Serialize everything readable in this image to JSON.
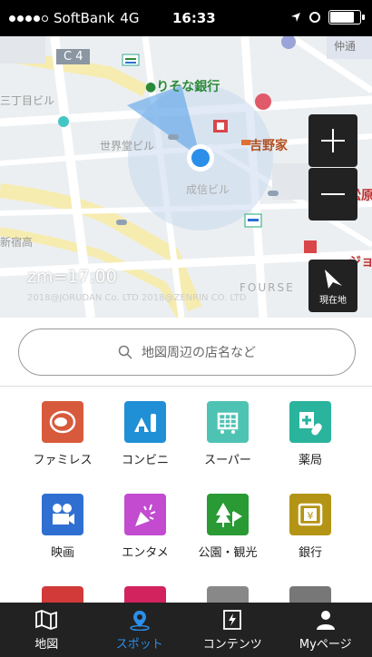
{
  "status_bar": {
    "carrier": "SoftBank",
    "network": "4G",
    "time": "16:33"
  },
  "map": {
    "labels": {
      "c4": "C 4",
      "resona": "りそな銀行",
      "sanchome": "三丁目ビル",
      "sekaido": "世界堂ビル",
      "yoshinoya": "吉野家",
      "seishin": "成信ビル",
      "matsumoto": "松原",
      "shinjuku_taka": "新宿高",
      "naka": "仲通",
      "fourse": "FOURSE",
      "jo": "ジョ"
    },
    "zoom_label": "zm=17.00",
    "copyright": "2018@JORUDAN Co. LTD 2018@ZENRIN CO. LTD",
    "location_caption": "現在地"
  },
  "search": {
    "placeholder": "地図周辺の店名など"
  },
  "categories": [
    {
      "label": "ファミレス",
      "color": "#d85a3c",
      "icon": "food-plate-icon"
    },
    {
      "label": "コンビニ",
      "color": "#1f8fd6",
      "icon": "onigiri-bottle-icon"
    },
    {
      "label": "スーパー",
      "color": "#4fc3b3",
      "icon": "shopping-cart-icon"
    },
    {
      "label": "薬局",
      "color": "#2ab39d",
      "icon": "medicine-icon"
    },
    {
      "label": "映画",
      "color": "#2f6fd1",
      "icon": "film-camera-icon"
    },
    {
      "label": "エンタメ",
      "color": "#c24bd0",
      "icon": "party-popper-icon"
    },
    {
      "label": "公園・観光",
      "color": "#2a9a35",
      "icon": "tree-flag-icon"
    },
    {
      "label": "銀行",
      "color": "#b49414",
      "icon": "atm-icon"
    },
    {
      "label": "",
      "color": "#d23a3a",
      "icon": "partial-icon"
    },
    {
      "label": "",
      "color": "#d2235f",
      "icon": "partial-icon"
    },
    {
      "label": "",
      "color": "#888888",
      "icon": "partial-icon"
    },
    {
      "label": "",
      "color": "#777777",
      "icon": "partial-icon"
    }
  ],
  "bottom_nav": [
    {
      "label": "地図",
      "icon": "map-icon"
    },
    {
      "label": "スポット",
      "icon": "pin-icon"
    },
    {
      "label": "コンテンツ",
      "icon": "content-icon"
    },
    {
      "label": "Myページ",
      "icon": "person-icon"
    }
  ]
}
